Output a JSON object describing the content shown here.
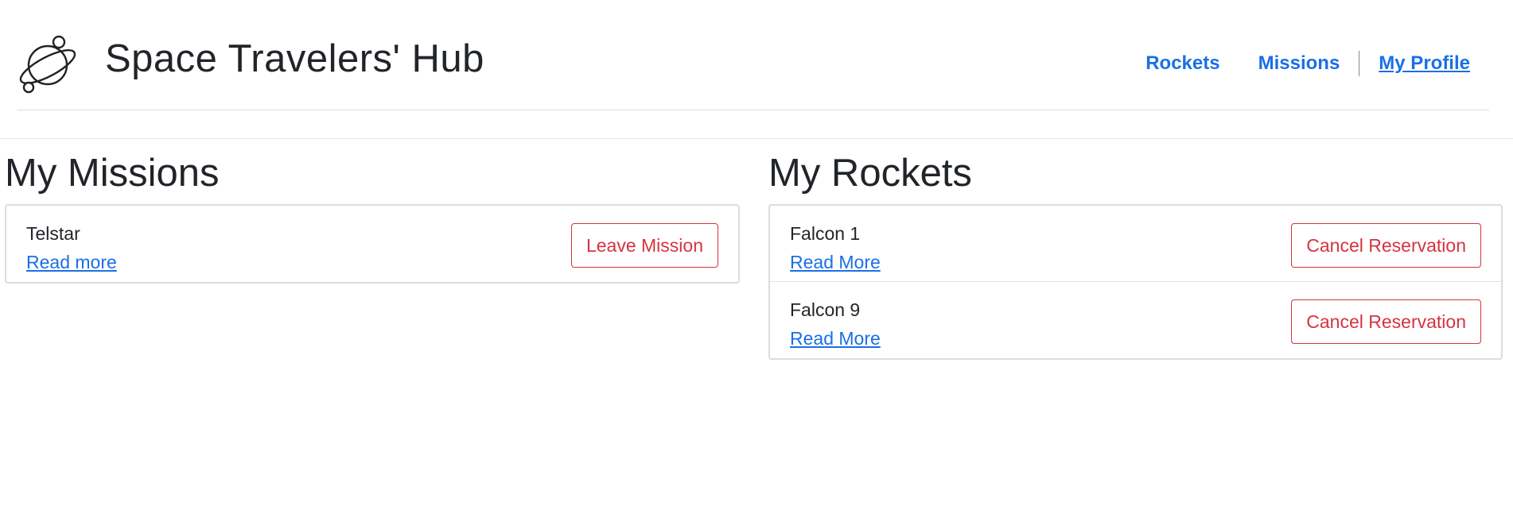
{
  "header": {
    "brand": "Space Travelers' Hub",
    "logo_icon": "planet-icon",
    "nav": {
      "rockets": "Rockets",
      "missions": "Missions",
      "my_profile": "My Profile"
    }
  },
  "missions": {
    "title": "My Missions",
    "items": [
      {
        "name": "Telstar",
        "link": "Read more",
        "button": "Leave Mission"
      }
    ]
  },
  "rockets": {
    "title": "My Rockets",
    "items": [
      {
        "name": "Falcon 1",
        "link": "Read More",
        "button": "Cancel Reservation"
      },
      {
        "name": "Falcon 9",
        "link": "Read More",
        "button": "Cancel Reservation"
      }
    ]
  },
  "colors": {
    "link": "#1a6fe6",
    "danger": "#d6333f",
    "text": "#212529"
  }
}
